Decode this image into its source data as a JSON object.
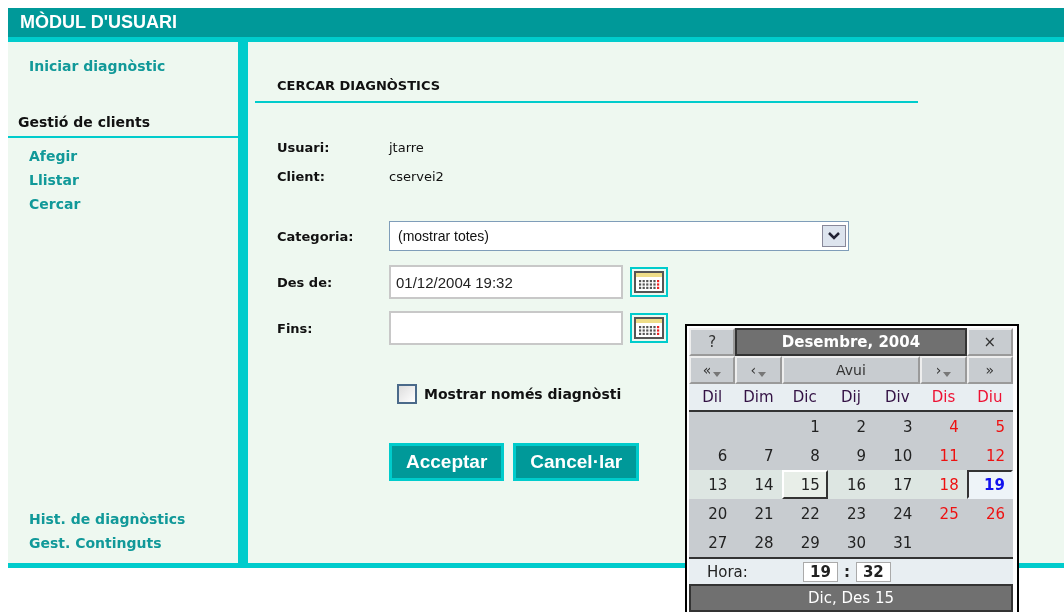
{
  "header": {
    "title": "MÒDUL D'USUARI"
  },
  "sidebar": {
    "top_link": "Iniciar diagnòstic",
    "section_title": "Gestió de clients",
    "items": [
      {
        "label": "Afegir"
      },
      {
        "label": "Llistar"
      },
      {
        "label": "Cercar"
      }
    ],
    "bottom_links": [
      {
        "label": "Hist. de diagnòstics"
      },
      {
        "label": "Gest. Continguts"
      }
    ]
  },
  "main": {
    "title": "CERCAR DIAGNÒSTICS",
    "info": [
      {
        "label": "Usuari:",
        "value": "jtarre"
      },
      {
        "label": "Client:",
        "value": "cservei2"
      }
    ],
    "category": {
      "label": "Categoria:",
      "value": "(mostrar totes)"
    },
    "from": {
      "label": "Des de:",
      "value": "01/12/2004 19:32"
    },
    "to": {
      "label": "Fins:"
    },
    "checkbox": {
      "label": "Mostrar només diagnòsti",
      "checked": false
    },
    "buttons": [
      {
        "label": "Acceptar"
      },
      {
        "label": "Cancel·lar"
      }
    ]
  },
  "calendar": {
    "help": "?",
    "title": "Desembre, 2004",
    "close": "×",
    "nav": [
      {
        "label": "«",
        "kind": "menu"
      },
      {
        "label": "‹",
        "kind": "menu"
      },
      {
        "label": "Avui",
        "kind": "today"
      },
      {
        "label": "›",
        "kind": "menu"
      },
      {
        "label": "»",
        "kind": "plain"
      }
    ],
    "weekdays": [
      {
        "label": "Dil",
        "weekend": false
      },
      {
        "label": "Dim",
        "weekend": false
      },
      {
        "label": "Dic",
        "weekend": false
      },
      {
        "label": "Dij",
        "weekend": false
      },
      {
        "label": "Div",
        "weekend": false
      },
      {
        "label": "Dis",
        "weekend": true
      },
      {
        "label": "Diu",
        "weekend": true
      }
    ],
    "weeks": [
      {
        "highlighted": false,
        "days": [
          {
            "label": "1",
            "weekend": false,
            "selected": false,
            "today": false
          },
          {
            "label": "2",
            "weekend": false,
            "selected": false,
            "today": false
          },
          {
            "label": "3",
            "weekend": false,
            "selected": false,
            "today": false
          },
          {
            "label": "4",
            "weekend": true,
            "selected": false,
            "today": false
          },
          {
            "label": "5",
            "weekend": true,
            "selected": false,
            "today": false
          }
        ]
      },
      {
        "highlighted": false,
        "days": [
          {
            "label": "6",
            "weekend": false,
            "selected": false,
            "today": false
          },
          {
            "label": "7",
            "weekend": false,
            "selected": false,
            "today": false
          },
          {
            "label": "8",
            "weekend": false,
            "selected": false,
            "today": false
          },
          {
            "label": "9",
            "weekend": false,
            "selected": false,
            "today": false
          },
          {
            "label": "10",
            "weekend": false,
            "selected": false,
            "today": false
          },
          {
            "label": "11",
            "weekend": true,
            "selected": false,
            "today": false
          },
          {
            "label": "12",
            "weekend": true,
            "selected": false,
            "today": false
          }
        ]
      },
      {
        "highlighted": true,
        "days": [
          {
            "label": "13",
            "weekend": false,
            "selected": false,
            "today": false
          },
          {
            "label": "14",
            "weekend": false,
            "selected": false,
            "today": false
          },
          {
            "label": "15",
            "weekend": false,
            "selected": true,
            "today": false
          },
          {
            "label": "16",
            "weekend": false,
            "selected": false,
            "today": false
          },
          {
            "label": "17",
            "weekend": false,
            "selected": false,
            "today": false
          },
          {
            "label": "18",
            "weekend": true,
            "selected": false,
            "today": false
          },
          {
            "label": "19",
            "weekend": true,
            "selected": false,
            "today": true
          }
        ]
      },
      {
        "highlighted": false,
        "days": [
          {
            "label": "20",
            "weekend": false,
            "selected": false,
            "today": false
          },
          {
            "label": "21",
            "weekend": false,
            "selected": false,
            "today": false
          },
          {
            "label": "22",
            "weekend": false,
            "selected": false,
            "today": false
          },
          {
            "label": "23",
            "weekend": false,
            "selected": false,
            "today": false
          },
          {
            "label": "24",
            "weekend": false,
            "selected": false,
            "today": false
          },
          {
            "label": "25",
            "weekend": true,
            "selected": false,
            "today": false
          },
          {
            "label": "26",
            "weekend": true,
            "selected": false,
            "today": false
          }
        ]
      },
      {
        "highlighted": false,
        "days": [
          {
            "label": "27",
            "weekend": false,
            "selected": false,
            "today": false
          },
          {
            "label": "28",
            "weekend": false,
            "selected": false,
            "today": false
          },
          {
            "label": "29",
            "weekend": false,
            "selected": false,
            "today": false
          },
          {
            "label": "30",
            "weekend": false,
            "selected": false,
            "today": false
          },
          {
            "label": "31",
            "weekend": false,
            "selected": false,
            "today": false
          }
        ]
      }
    ],
    "time": {
      "label": "Hora:",
      "hour": "19",
      "separator": ":",
      "minute": "32"
    },
    "status": "Dic, Des 15"
  }
}
